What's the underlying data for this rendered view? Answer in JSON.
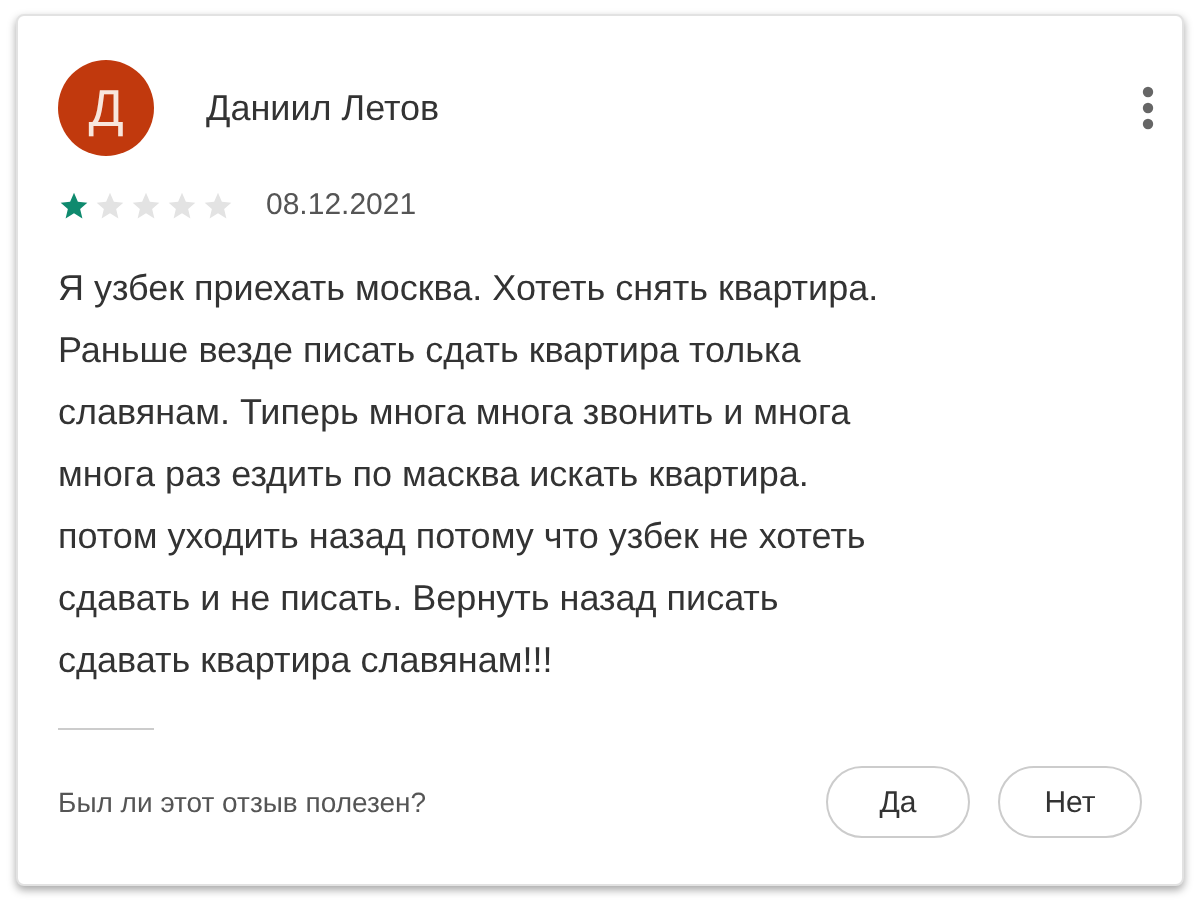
{
  "review": {
    "avatar_letter": "Д",
    "author": "Даниил Летов",
    "stars": 1,
    "date": "08.12.2021",
    "text_lines": [
      "Я узбек приехать москва. Хотеть снять квартира.",
      "Раньше везде писать сдать квартира толька",
      "славянам. Типерь многа многа звонить и многа",
      "многа раз ездить по масква искать квартира.",
      "потом уходить назад потому что узбек не хотеть",
      "сдавать и не писать. Вернуть назад писать",
      "сдавать квартира славянам!!!"
    ],
    "helpful_question": "Был ли этот отзыв полезен?",
    "buttons": [
      "Да",
      "Нет"
    ]
  }
}
